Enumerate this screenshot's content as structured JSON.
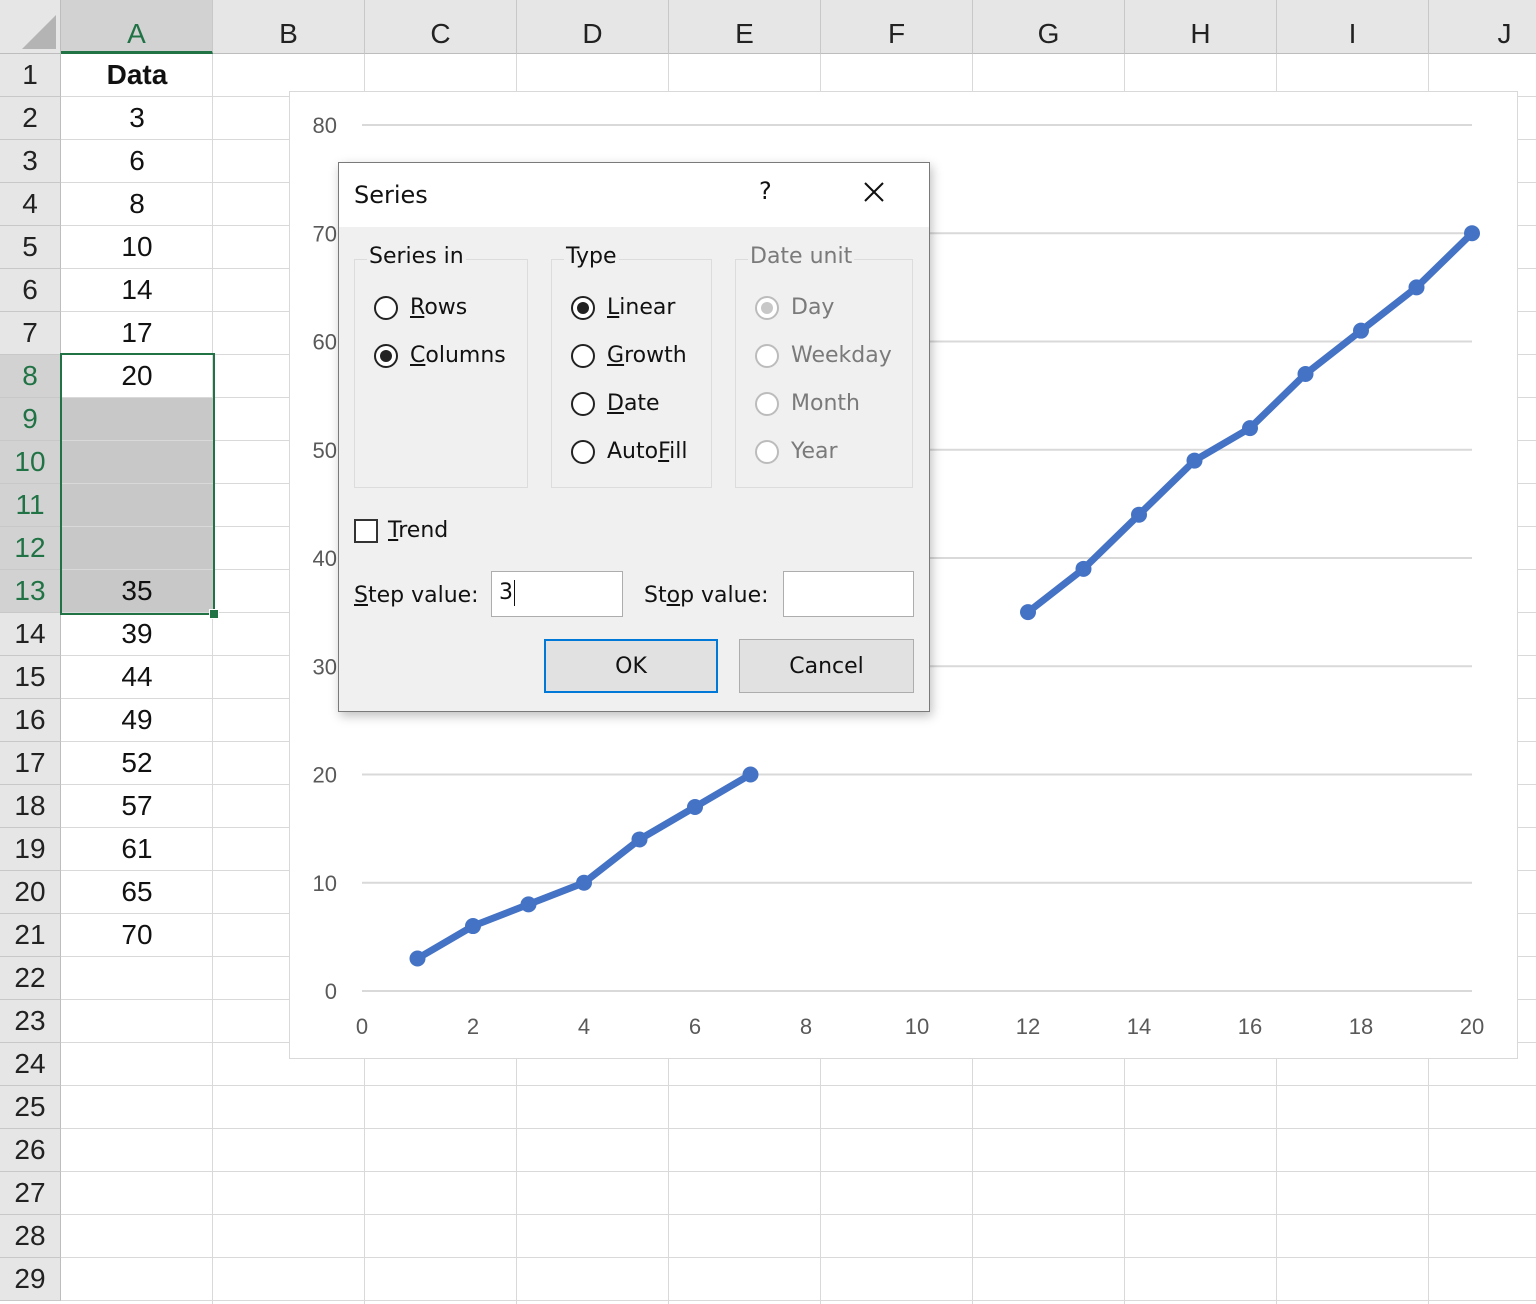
{
  "spreadsheet": {
    "columns": [
      "A",
      "B",
      "C",
      "D",
      "E",
      "F",
      "G",
      "H",
      "I",
      "J"
    ],
    "selected_column": "A",
    "rows": [
      "1",
      "2",
      "3",
      "4",
      "5",
      "6",
      "7",
      "8",
      "9",
      "10",
      "11",
      "12",
      "13",
      "14",
      "15",
      "16",
      "17",
      "18",
      "19",
      "20",
      "21",
      "22",
      "23",
      "24",
      "25",
      "26",
      "27",
      "28",
      "29"
    ],
    "selected_rows": [
      "8",
      "9",
      "10",
      "11",
      "12",
      "13"
    ],
    "column_a": [
      "Data",
      "3",
      "6",
      "8",
      "10",
      "14",
      "17",
      "20",
      "",
      "",
      "",
      "",
      "35",
      "39",
      "44",
      "49",
      "52",
      "57",
      "61",
      "65",
      "70",
      "",
      "",
      "",
      "",
      "",
      "",
      "",
      ""
    ],
    "selection_range": "A8:A13"
  },
  "chart_data": {
    "type": "line",
    "title": "",
    "xlabel": "",
    "ylabel": "",
    "xlim": [
      0,
      20
    ],
    "ylim": [
      0,
      80
    ],
    "x_ticks": [
      "0",
      "2",
      "4",
      "6",
      "8",
      "10",
      "12",
      "14",
      "16",
      "18",
      "20"
    ],
    "y_ticks": [
      "0",
      "10",
      "20",
      "30",
      "40",
      "50",
      "60",
      "70",
      "80"
    ],
    "grid": true,
    "legend": "none",
    "series": [
      {
        "name": "Data",
        "color": "#4472c4",
        "x": [
          1,
          2,
          3,
          4,
          5,
          6,
          7,
          8,
          9,
          10,
          11,
          12,
          13,
          14,
          15,
          16,
          17,
          18,
          19,
          20
        ],
        "values": [
          3,
          6,
          8,
          10,
          14,
          17,
          20,
          null,
          null,
          null,
          null,
          35,
          39,
          44,
          49,
          52,
          57,
          61,
          65,
          70
        ]
      }
    ]
  },
  "dialog": {
    "title": "Series",
    "help_label": "?",
    "series_in": {
      "label": "Series in",
      "options": [
        {
          "pre": "",
          "key": "R",
          "post": "ows",
          "checked": false
        },
        {
          "pre": "",
          "key": "C",
          "post": "olumns",
          "checked": true
        }
      ]
    },
    "type": {
      "label": "Type",
      "options": [
        {
          "pre": "",
          "key": "L",
          "post": "inear",
          "checked": true
        },
        {
          "pre": "",
          "key": "G",
          "post": "rowth",
          "checked": false
        },
        {
          "pre": "",
          "key": "D",
          "post": "ate",
          "checked": false
        },
        {
          "pre": "Auto",
          "key": "F",
          "post": "ill",
          "checked": false
        }
      ]
    },
    "date_unit": {
      "label": "Date unit",
      "disabled": true,
      "options": [
        {
          "pre": "Day",
          "key": "",
          "post": "",
          "checked": true
        },
        {
          "pre": "Weekday",
          "key": "",
          "post": "",
          "checked": false
        },
        {
          "pre": "Month",
          "key": "",
          "post": "",
          "checked": false
        },
        {
          "pre": "Year",
          "key": "",
          "post": "",
          "checked": false
        }
      ]
    },
    "trend": {
      "pre": "",
      "key": "T",
      "post": "rend",
      "checked": false
    },
    "step": {
      "pre": "",
      "key": "S",
      "post": "tep value:",
      "value": "3"
    },
    "stop": {
      "pre": "St",
      "key": "o",
      "post": "p value:",
      "value": ""
    },
    "ok_label": "OK",
    "cancel_label": "Cancel"
  }
}
